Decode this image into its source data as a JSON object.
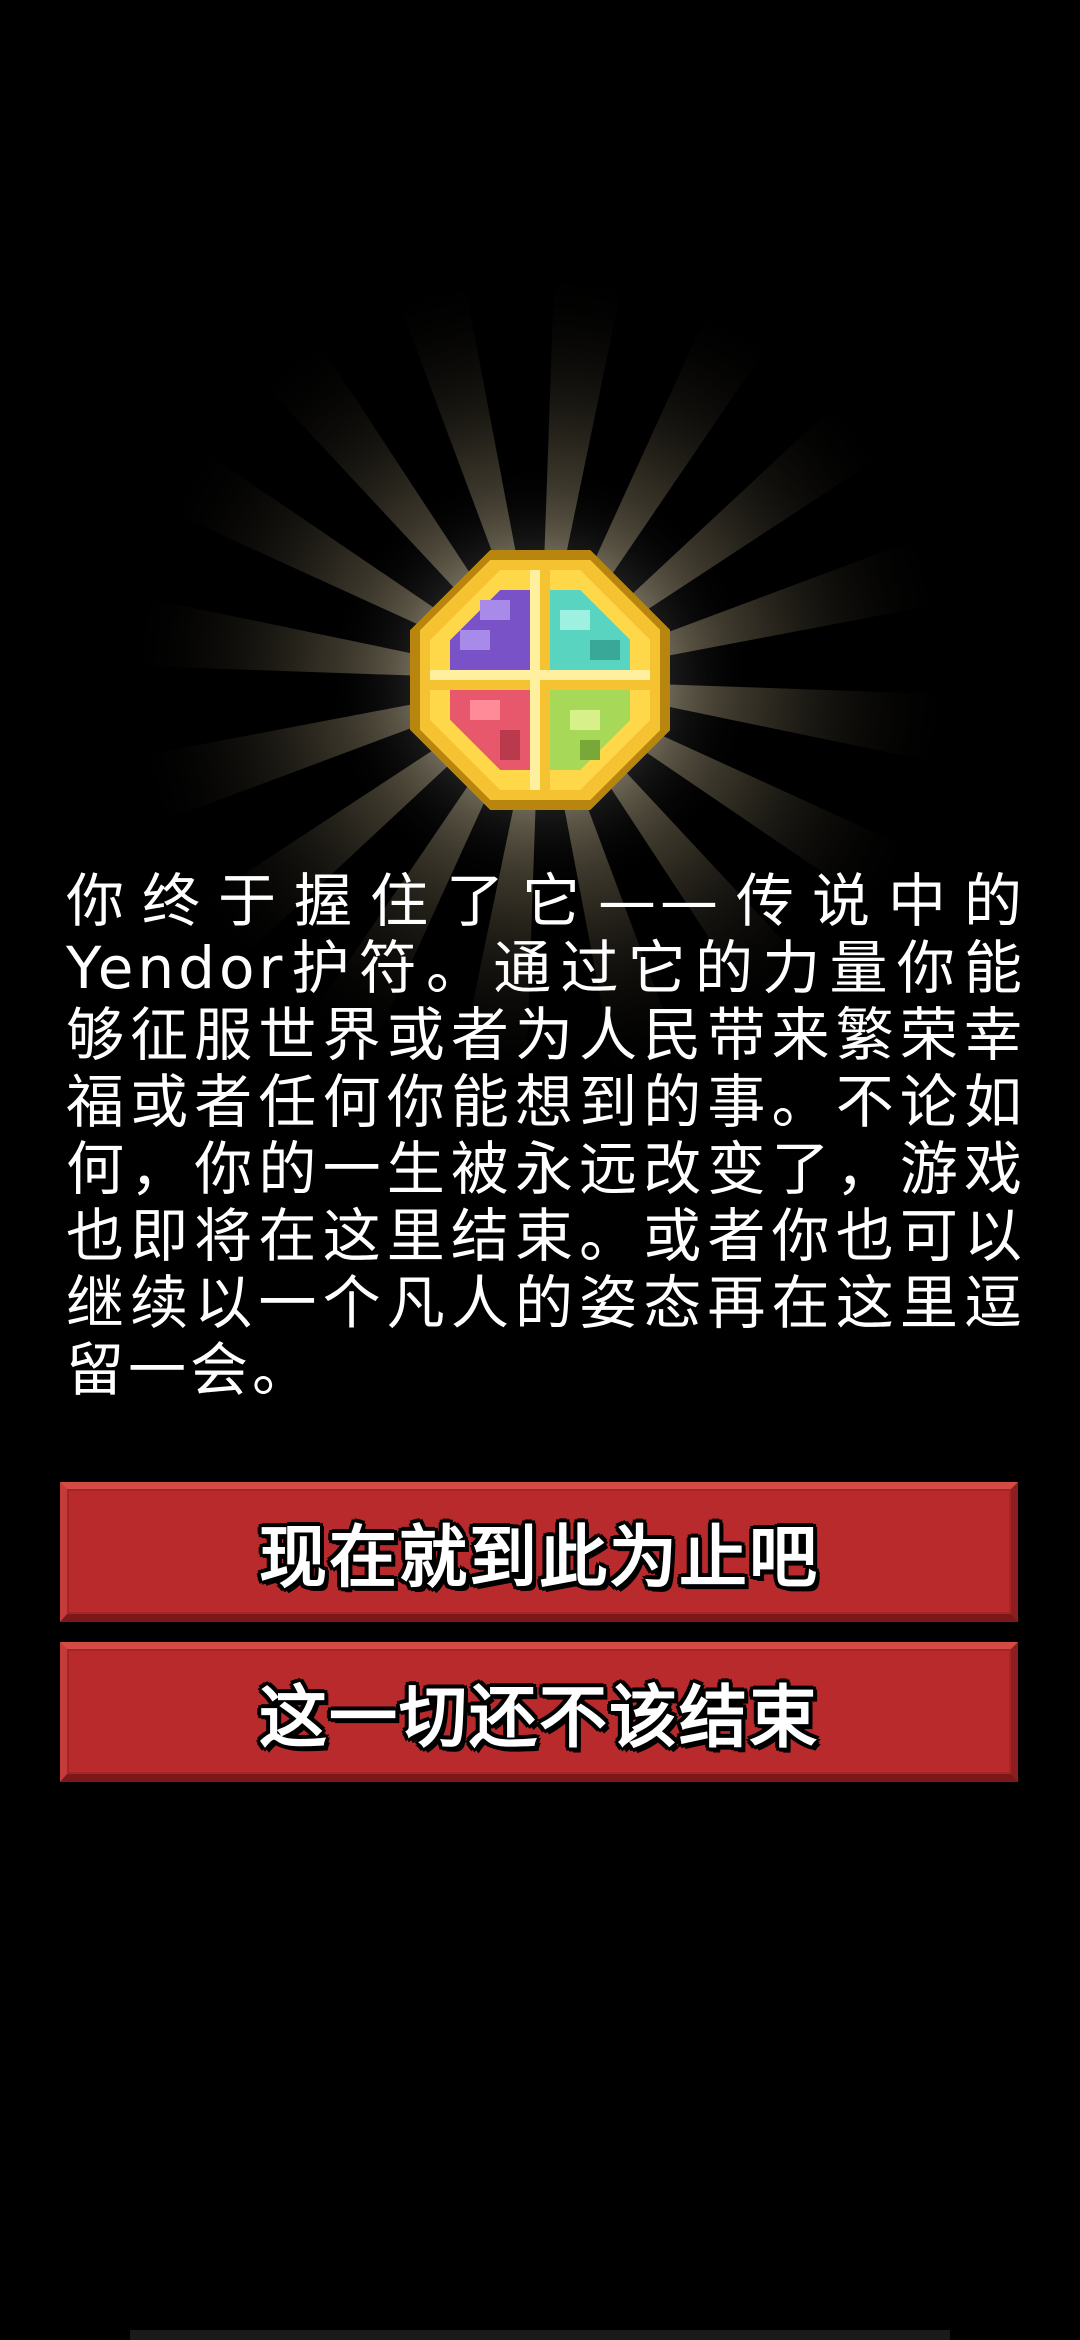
{
  "story": {
    "text": "你终于握住了它——传说中的Yendor护符。通过它的力量你能够征服世界或者为人民带来繁荣幸福或者任何你能想到的事。不论如何，你的一生被永远改变了，游戏也即将在这里结束。或者你也可以继续以一个凡人的姿态再在这里逗留一会。"
  },
  "buttons": {
    "end_label": "现在就到此为止吧",
    "continue_label": "这一切还不该结束"
  },
  "icons": {
    "amulet": "amulet-of-yendor-icon"
  },
  "colors": {
    "background": "#000000",
    "button": "#b82a2c",
    "gold": "#f5c232",
    "purple": "#7a52c8",
    "teal": "#58d4c0",
    "pink": "#e8586c",
    "green": "#a8d858"
  }
}
